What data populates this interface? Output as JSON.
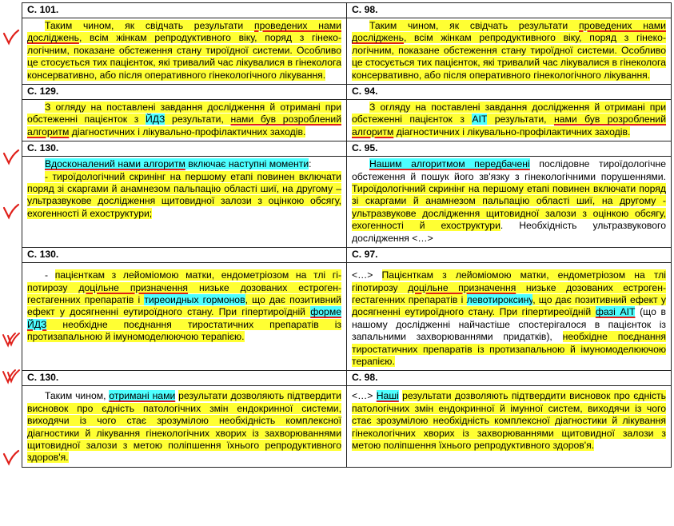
{
  "colors": {
    "highlight_yellow": "#ffff33",
    "highlight_cyan": "#4dffff",
    "pen_red": "#e0201a",
    "border": "#222222"
  },
  "margin_marks": [
    "check-mark-icon",
    "check-mark-icon",
    "check-mark-icon",
    "check-mark-icon",
    "check-mark-icon",
    "check-mark-icon"
  ],
  "rows": [
    {
      "left_page": "С. 101.",
      "right_page": "С. 98.",
      "left": {
        "a": "Таким чином, як свідчать результати ",
        "b": "проведених нами досліджень",
        "c": ", всім жінкам репродуктивного віку, поряд з гінеко­логічним, показане обстеження стану тироїдної системи. Особливо це стосується тих пацієнток, які тривалий час ліку­валися в гінеколога консервативно, або після оперативного гінекологічного лікування."
      },
      "right": {
        "a": "Таким чином, як свідчать результати ",
        "b": "проведених нами досліджень",
        "c": ", всім жінкам репродуктивного віку, поряд з гінеко­логічним, показане обстеження стану тироїдної системи. Особливо це стосується тих пацієнток, які тривалий час ліку­валися в гінеколога консервативно, або після оперативного гінекологічного лікування."
      }
    },
    {
      "left_page": "С. 129.",
      "right_page": "С. 94.",
      "left": {
        "a": "З огляду на поставлені завдання дослідження й отримані при обстеженні пацієнток з ",
        "b": "ЙДЗ",
        "c": " результати, ",
        "d": "нами був роз­роблений алгоритм",
        "e": " діагностичних і лікувально-профілактич­них заходів."
      },
      "right": {
        "a": "З огляду на поставлені завдання дослідження й отримані при обстеженні пацієнток з ",
        "b": "АІТ",
        "c": " результати, ",
        "d": "нами був розроб­лений алгоритм",
        "e": " діагностичних і лікувально-профілактичних заходів."
      }
    },
    {
      "left_page": "С. 130.",
      "right_page": "С. 95.",
      "left": {
        "a": "Вдосконалений нами алгоритм",
        "b": " включає наступні моменти",
        "c": ":",
        "d": "- тироїдологічний скринінг на першому етапі повинен включати поряд зі скаргами й анамнезом пальпацію області шиї, на другому – ультразвукове дослідження щитовидної залози з оцінкою обсягу, ехогенності й ехоструктури;"
      },
      "right": {
        "a": "Нашим алгоритмом передбачені",
        "b": " послідовне тироїдологіч­не обстеження й пошук його зв'язку з гінекологічними пору­шеннями. ",
        "c": "Тироїдологічний скринінг на першому етапі пови­нен включати поряд зі скаргами й анамнезом пальпацію об­ласті шиї, на другому - ультразвукове дослідження щитовид­ної залози з оцінкою обсягу, ехогенності й ехоструктури",
        "d": ". Не­обхідність ультразвукового дослідження <…>"
      }
    },
    {
      "left_page": "С. 130.",
      "right_page": "С. 97.",
      "left": {
        "a": "- ",
        "b": "пацієнткам з лейоміомою матки, ендометріозом на тлі гі­потирозу ",
        "c": "доцільне призначення",
        "d": " низьке дозованих естроген­гестагенних препаратів і ",
        "e": "тиреоидных гормонов",
        "f": ", що дає пози­тивний ефект у досягненні еутироїдного стану. При гіпертиро­їдній ",
        "g": "форме ЙДЗ",
        "h": " необхідне поєднання тиростатичних препара­тів із протизапальною й імуномоделюючою терапією."
      },
      "right": {
        "a": "<…> ",
        "b": "Пацієнткам з лейоміомою матки, ендометріозом на тлі гіпотирозу ",
        "c": "доцільне призначення",
        "d": " низьке дозованих естроген­гестагенних препаратів і ",
        "e": "левотироксину",
        "f": ", що дає позитивний ефект у досягненні еутироїдного стану. При гіпертиреоїдній ",
        "g": "фазі АІТ",
        "h": " (що в нашому дослідженні найчастіше спостерігало­ся в пацієнток із запальними захворюваннями придатків), ",
        "i": "необхідне поєднання тиростатичних препаратів із протиза­пальною й імуномоделюючою терапією."
      }
    },
    {
      "left_page": "С. 130.",
      "right_page": "С. 98.",
      "left": {
        "a": "Таким чином, ",
        "b": "отримані нами",
        "c": " ",
        "d": "результати дозволяють під­твердити висновок про єдність патологічних змін ендокринної системи, виходячи із чого стає зрозумілою необхідність ком­плексної діагностики й лікування гінекологічних хворих із захворюваннями щитовидної залози з метою поліпшення їхнього репродуктивного здоров'я."
      },
      "right": {
        "a": "<…> ",
        "b": "Наші",
        "c": " ",
        "d": "результати дозволяють підтвердити висновок про єдність патологічних змін ендокринної й імунної систем, ви­ходячи із чого стає зрозумілою необхідність комплексної діагностики й лікування гінекологічних хворих із захворюван­нями щитовидної залози з метою поліпшення їхнього репро­дуктивного здоров'я."
      }
    }
  ]
}
